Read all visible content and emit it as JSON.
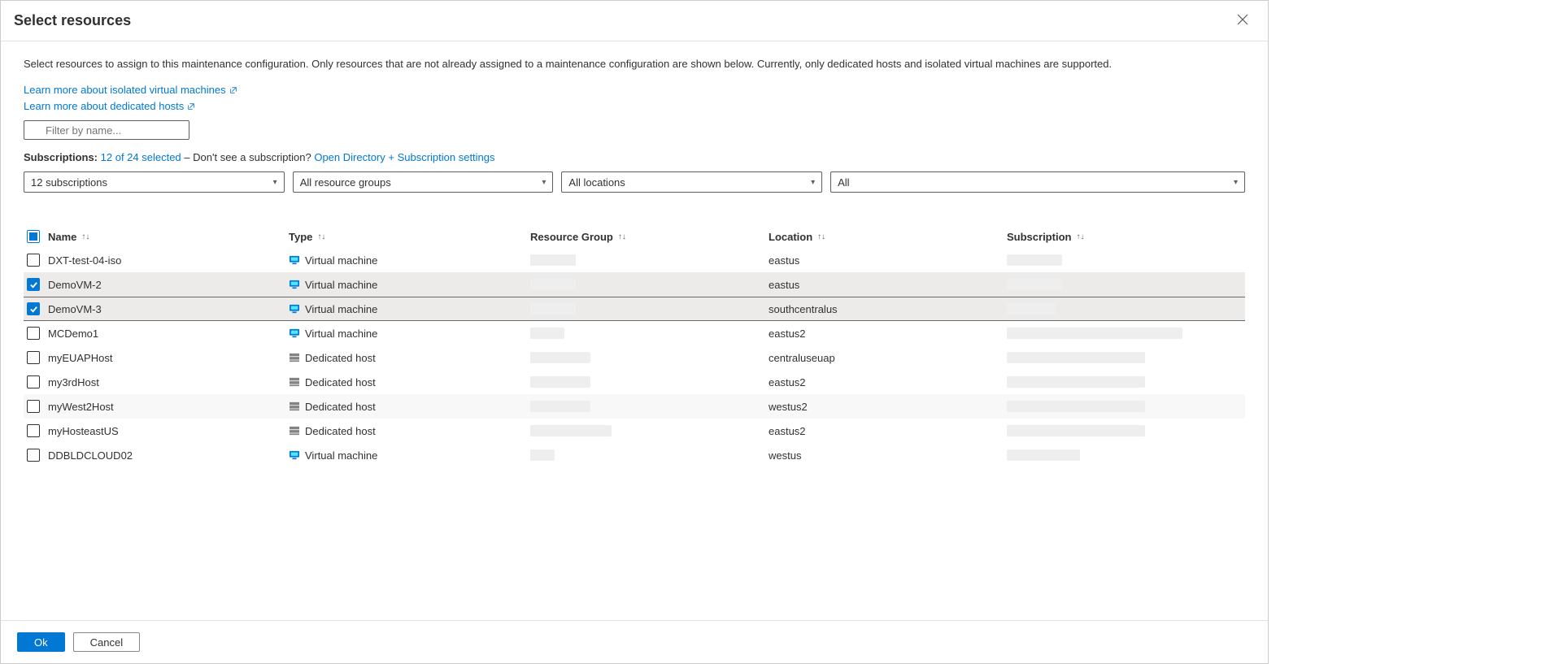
{
  "header": {
    "title": "Select resources"
  },
  "description": "Select resources to assign to this maintenance configuration. Only resources that are not already assigned to a maintenance configuration are shown below. Currently, only dedicated hosts and isolated virtual machines are supported.",
  "links": {
    "isolated": "Learn more about isolated virtual machines",
    "dedicated": "Learn more about dedicated hosts"
  },
  "filter": {
    "placeholder": "Filter by name..."
  },
  "subscriptionsLine": {
    "label": "Subscriptions:",
    "selected": "12 of 24 selected",
    "middle": "– Don't see a subscription?",
    "openSettings": "Open Directory + Subscription settings"
  },
  "dropdowns": {
    "subs": "12 subscriptions",
    "rg": "All resource groups",
    "loc": "All locations",
    "all": "All"
  },
  "columns": {
    "name": "Name",
    "type": "Type",
    "rg": "Resource Group",
    "loc": "Location",
    "sub": "Subscription"
  },
  "rows": [
    {
      "checked": false,
      "name": "DXT-test-04-iso",
      "type": "Virtual machine",
      "typeIcon": "vm",
      "rgW": 56,
      "loc": "eastus",
      "subW": 68,
      "alt": false
    },
    {
      "checked": true,
      "name": "DemoVM-2",
      "type": "Virtual machine",
      "typeIcon": "vm",
      "rgW": 56,
      "loc": "eastus",
      "subW": 68,
      "alt": true,
      "selected": true
    },
    {
      "checked": true,
      "name": "DemoVM-3",
      "type": "Virtual machine",
      "typeIcon": "vm",
      "rgW": 56,
      "loc": "southcentralus",
      "subW": 60,
      "alt": false,
      "highlighted": true
    },
    {
      "checked": false,
      "name": "MCDemo1",
      "type": "Virtual machine",
      "typeIcon": "vm",
      "rgW": 42,
      "loc": "eastus2",
      "subW": 216,
      "alt": false
    },
    {
      "checked": false,
      "name": "myEUAPHost",
      "type": "Dedicated host",
      "typeIcon": "host",
      "rgW": 74,
      "loc": "centraluseuap",
      "subW": 170,
      "alt": false
    },
    {
      "checked": false,
      "name": "my3rdHost",
      "type": "Dedicated host",
      "typeIcon": "host",
      "rgW": 74,
      "loc": "eastus2",
      "subW": 170,
      "alt": false
    },
    {
      "checked": false,
      "name": "myWest2Host",
      "type": "Dedicated host",
      "typeIcon": "host",
      "rgW": 74,
      "loc": "westus2",
      "subW": 170,
      "alt": true
    },
    {
      "checked": false,
      "name": "myHosteastUS",
      "type": "Dedicated host",
      "typeIcon": "host",
      "rgW": 100,
      "loc": "eastus2",
      "subW": 170,
      "alt": false
    },
    {
      "checked": false,
      "name": "DDBLDCLOUD02",
      "type": "Virtual machine",
      "typeIcon": "vm",
      "rgW": 30,
      "loc": "westus",
      "subW": 90,
      "alt": false
    }
  ],
  "footer": {
    "ok": "Ok",
    "cancel": "Cancel"
  }
}
